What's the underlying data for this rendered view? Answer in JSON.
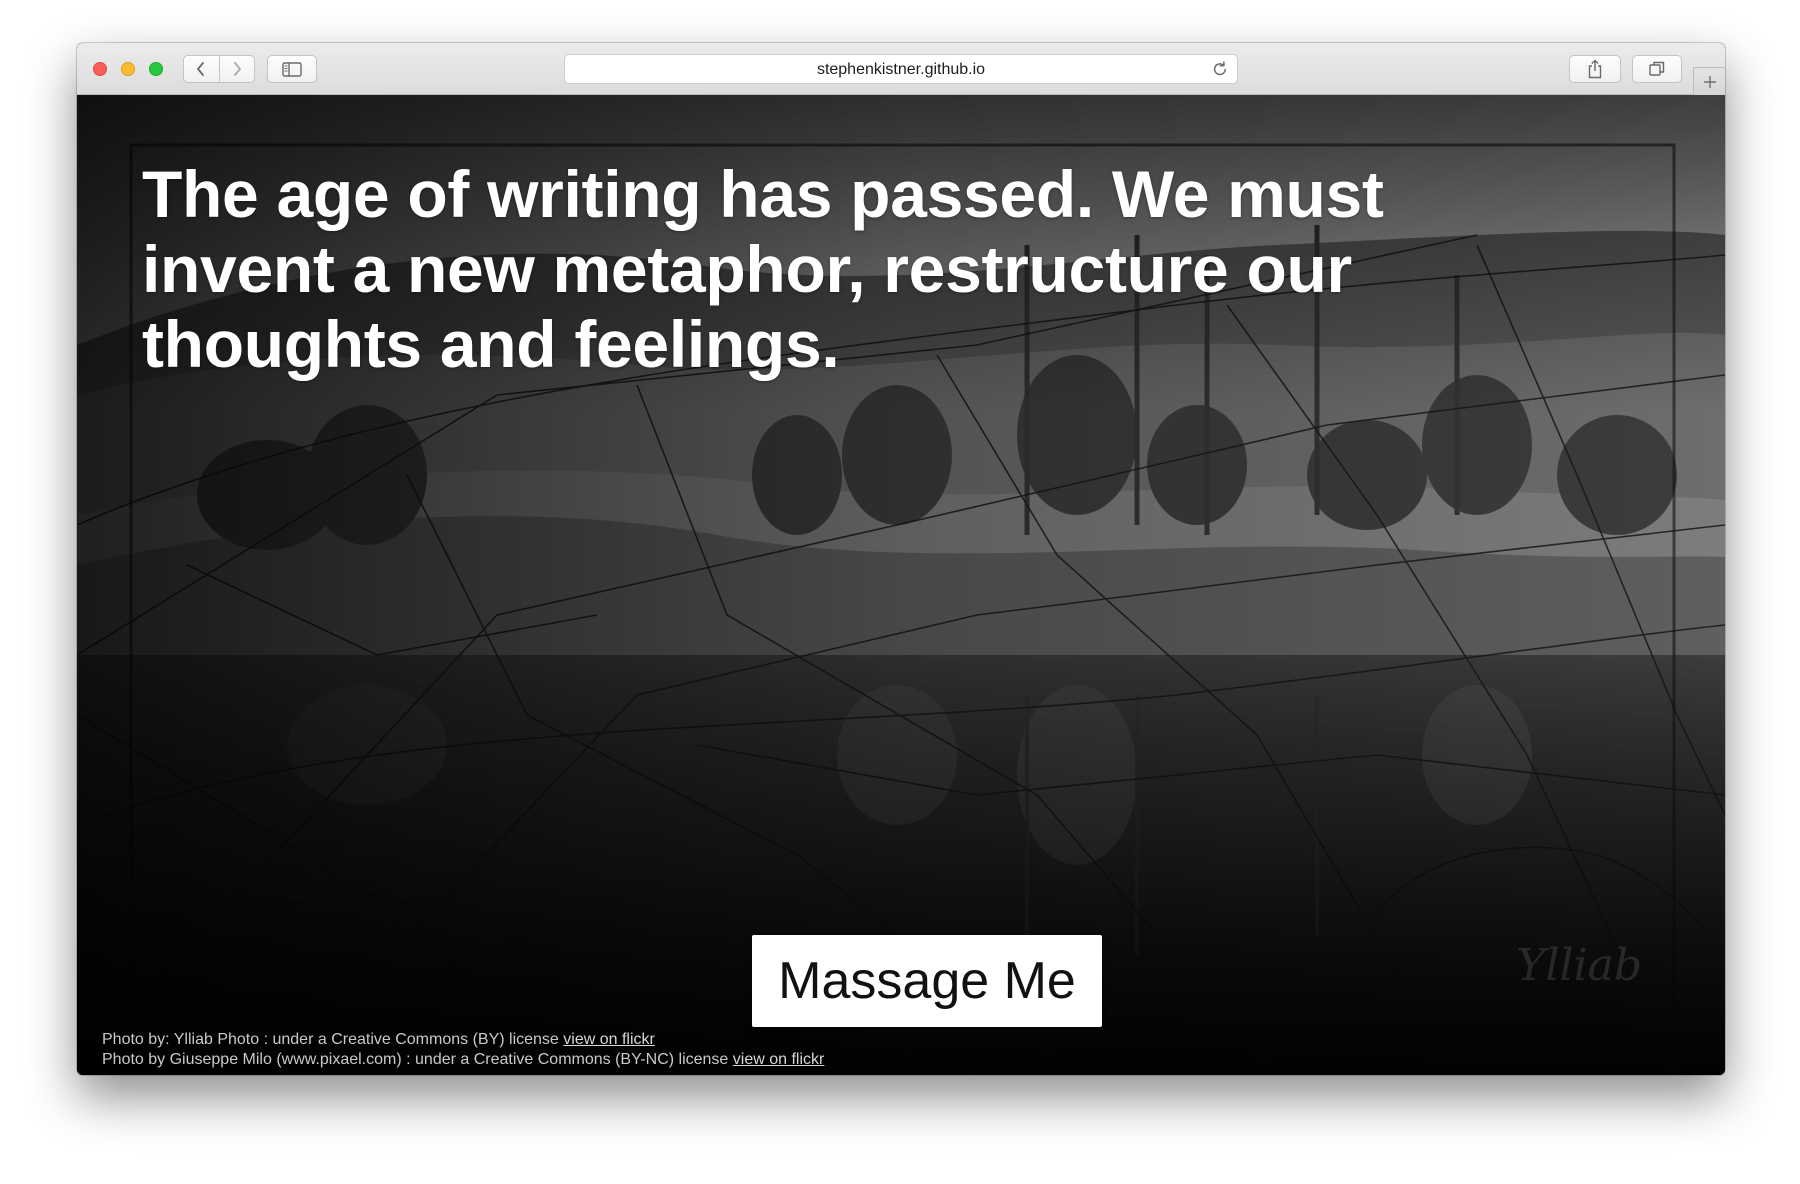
{
  "browser": {
    "url": "stephenkistner.github.io"
  },
  "page": {
    "headline": "The age of writing has passed. We must invent a new metaphor, restructure our thoughts and feelings.",
    "cta_label": "Massage Me",
    "watermark": "Ylliab"
  },
  "credits": [
    {
      "text": "Photo by: Ylliab Photo : under a Creative Commons (BY) license",
      "link_text": "view on flickr"
    },
    {
      "text": "Photo by Giuseppe Milo (www.pixael.com) : under a Creative Commons (BY-NC) license",
      "link_text": "view on flickr"
    }
  ],
  "icons": {
    "back": "chevron-left-icon",
    "forward": "chevron-right-icon",
    "sidebar": "sidebar-icon",
    "reload": "reload-icon",
    "share": "share-icon",
    "tabs": "tabs-overview-icon",
    "new_tab": "plus-icon"
  },
  "colors": {
    "close": "#fc5f57",
    "minimize": "#fdbc2e",
    "zoom": "#29c840"
  }
}
